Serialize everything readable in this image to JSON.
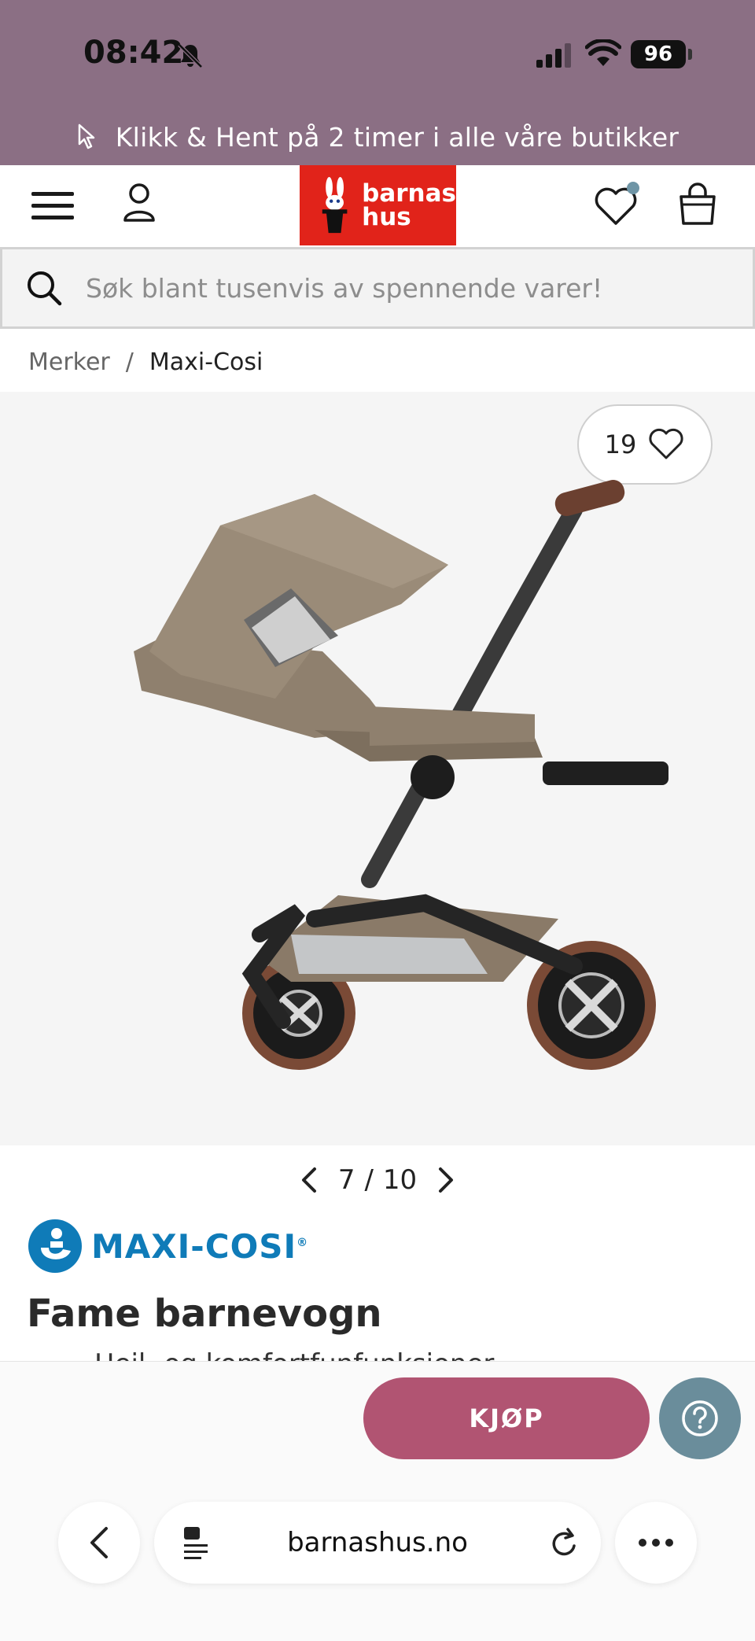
{
  "status_bar": {
    "time": "08:42",
    "battery": "96"
  },
  "promo": {
    "text": "Klikk & Hent på 2 timer i alle våre butikker"
  },
  "header": {
    "logo_line1": "barnas",
    "logo_line2": "hus"
  },
  "search": {
    "placeholder": "Søk blant tusenvis av spennende varer!"
  },
  "breadcrumb": {
    "items": [
      "Merker",
      "Maxi-Cosi"
    ],
    "separator": "/"
  },
  "gallery": {
    "favorites_count": "19",
    "current": "7",
    "separator": "/",
    "total": "10"
  },
  "product": {
    "brand": "MAXI-COSI",
    "brand_reg": "®",
    "title": "Fame barnevogn",
    "subtitle": "Heil- og komfortfunfunksjoner"
  },
  "buy_bar": {
    "buy_label": "KJØP"
  },
  "browser": {
    "url": "barnashus.no"
  },
  "colors": {
    "top_band": "#8b6f84",
    "logo_red": "#e1231a",
    "buy_button": "#b15472",
    "help_button": "#6a8d9b",
    "brand_blue": "#0f7bb8",
    "heart_dot": "#6f95a6"
  },
  "icons": [
    "bell-slash-icon",
    "signal-icon",
    "wifi-icon",
    "cursor-icon",
    "menu-icon",
    "user-icon",
    "heart-icon",
    "shopping-bag-icon",
    "search-icon",
    "chevron-left-icon",
    "chevron-right-icon",
    "question-icon",
    "reader-icon",
    "reload-icon",
    "more-icon"
  ]
}
